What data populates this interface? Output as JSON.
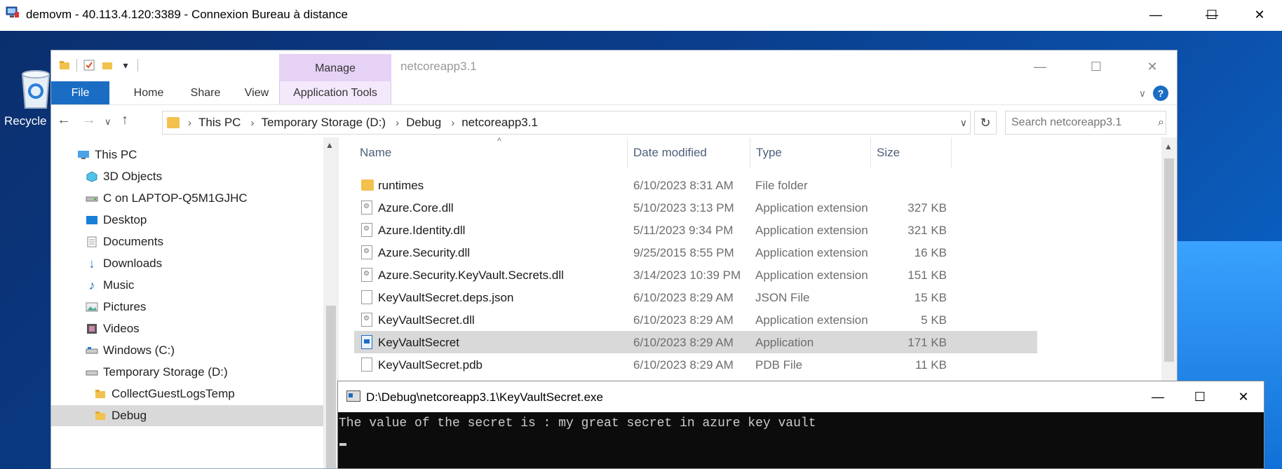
{
  "rdp": {
    "title": "demovm - 40.113.4.120:3389 - Connexion Bureau à distance",
    "minimize": "—",
    "maximize": "☐",
    "close": "✕"
  },
  "desktop": {
    "recycle_label": "Recycle"
  },
  "explorer": {
    "title": "netcoreapp3.1",
    "manage_label": "Manage",
    "tabs": {
      "file": "File",
      "home": "Home",
      "share": "Share",
      "view": "View",
      "app_tools": "Application Tools"
    },
    "breadcrumb": [
      "This PC",
      "Temporary Storage (D:)",
      "Debug",
      "netcoreapp3.1"
    ],
    "search_placeholder": "Search netcoreapp3.1",
    "nav": [
      {
        "label": "This PC",
        "icon": "pc-icon"
      },
      {
        "label": "3D Objects",
        "icon": "cube-icon"
      },
      {
        "label": "C on LAPTOP-Q5M1GJHC",
        "icon": "network-drive-icon"
      },
      {
        "label": "Desktop",
        "icon": "desktop-icon"
      },
      {
        "label": "Documents",
        "icon": "documents-icon"
      },
      {
        "label": "Downloads",
        "icon": "download-icon"
      },
      {
        "label": "Music",
        "icon": "music-icon"
      },
      {
        "label": "Pictures",
        "icon": "pictures-icon"
      },
      {
        "label": "Videos",
        "icon": "videos-icon"
      },
      {
        "label": "Windows (C:)",
        "icon": "drive-icon"
      },
      {
        "label": "Temporary Storage (D:)",
        "icon": "drive-icon"
      },
      {
        "label": "CollectGuestLogsTemp",
        "icon": "folder-icon"
      },
      {
        "label": "Debug",
        "icon": "folder-icon"
      }
    ],
    "columns": {
      "name": "Name",
      "date": "Date modified",
      "type": "Type",
      "size": "Size"
    },
    "files": [
      {
        "name": "runtimes",
        "date": "6/10/2023 8:31 AM",
        "type": "File folder",
        "size": "",
        "kind": "folder"
      },
      {
        "name": "Azure.Core.dll",
        "date": "5/10/2023 3:13 PM",
        "type": "Application extension",
        "size": "327 KB",
        "kind": "dll"
      },
      {
        "name": "Azure.Identity.dll",
        "date": "5/11/2023 9:34 PM",
        "type": "Application extension",
        "size": "321 KB",
        "kind": "dll"
      },
      {
        "name": "Azure.Security.dll",
        "date": "9/25/2015 8:55 PM",
        "type": "Application extension",
        "size": "16 KB",
        "kind": "dll"
      },
      {
        "name": "Azure.Security.KeyVault.Secrets.dll",
        "date": "3/14/2023 10:39 PM",
        "type": "Application extension",
        "size": "151 KB",
        "kind": "dll"
      },
      {
        "name": "KeyVaultSecret.deps.json",
        "date": "6/10/2023 8:29 AM",
        "type": "JSON File",
        "size": "15 KB",
        "kind": "file"
      },
      {
        "name": "KeyVaultSecret.dll",
        "date": "6/10/2023 8:29 AM",
        "type": "Application extension",
        "size": "5 KB",
        "kind": "dll"
      },
      {
        "name": "KeyVaultSecret",
        "date": "6/10/2023 8:29 AM",
        "type": "Application",
        "size": "171 KB",
        "kind": "app"
      },
      {
        "name": "KeyVaultSecret.pdb",
        "date": "6/10/2023 8:29 AM",
        "type": "PDB File",
        "size": "11 KB",
        "kind": "file"
      }
    ]
  },
  "console": {
    "title": "D:\\Debug\\netcoreapp3.1\\KeyVaultSecret.exe",
    "output": "The value of the secret is : my great secret in azure key vault"
  }
}
